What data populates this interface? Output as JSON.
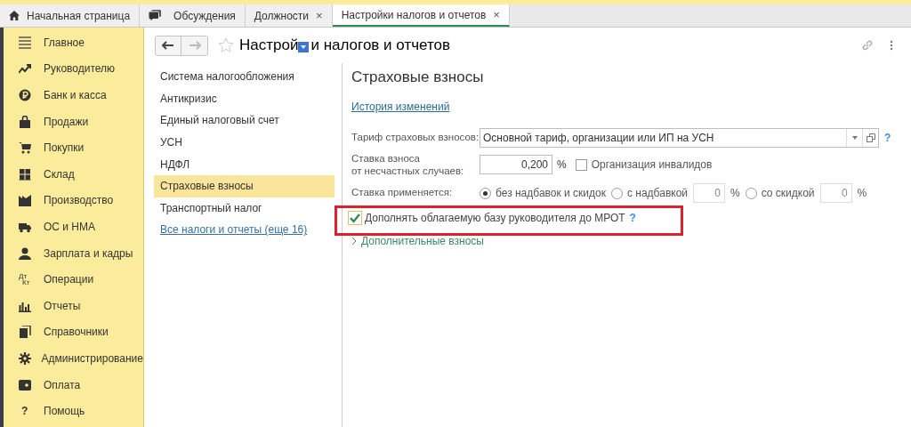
{
  "tabs": [
    {
      "label": "Начальная страница",
      "selected": false
    },
    {
      "label": "Обсуждения",
      "selected": false
    },
    {
      "label": "Должности",
      "close": "×",
      "selected": false
    },
    {
      "label": "Настройки налогов и отчетов",
      "close": "×",
      "selected": true
    }
  ],
  "sidebar": {
    "items": [
      {
        "label": "Главное"
      },
      {
        "label": "Руководителю"
      },
      {
        "label": "Банк и касса"
      },
      {
        "label": "Продажи"
      },
      {
        "label": "Покупки"
      },
      {
        "label": "Склад"
      },
      {
        "label": "Производство"
      },
      {
        "label": "ОС и НМА"
      },
      {
        "label": "Зарплата и кадры"
      },
      {
        "label": "Операции",
        "icon_text": [
          "Дт",
          "Кт"
        ]
      },
      {
        "label": "Отчеты"
      },
      {
        "label": "Справочники"
      },
      {
        "label": "Администрирование"
      },
      {
        "label": "Оплата"
      },
      {
        "label": "Помощь",
        "icon_text": [
          "?"
        ]
      }
    ]
  },
  "header": {
    "title_start": "Настрой",
    "title_end": "и налогов и отчетов"
  },
  "sections": {
    "items": [
      {
        "label": "Система налогообложения",
        "selected": false
      },
      {
        "label": "Антикризис",
        "selected": false
      },
      {
        "label": "Единый налоговый счет",
        "selected": false
      },
      {
        "label": "УСН",
        "selected": false
      },
      {
        "label": "НДФЛ",
        "selected": false
      },
      {
        "label": "Страховые взносы",
        "selected": true
      },
      {
        "label": "Транспортный налог",
        "selected": false
      }
    ],
    "more_link": "Все налоги и отчеты (еще 16)"
  },
  "content": {
    "title": "Страховые взносы",
    "history_link": "История изменений",
    "tariff": {
      "label": "Тариф страховых взносов:",
      "value": "Основной тариф, организации или ИП на УСН",
      "help": "?"
    },
    "accident_rate": {
      "label_line1": "Ставка взноса",
      "label_line2": "от несчастных случаев:",
      "value": "0,200",
      "unit": "%"
    },
    "disabled_org": {
      "label": "Организация инвалидов",
      "checked": false
    },
    "rate_applies": {
      "label": "Ставка применяется:",
      "options": [
        {
          "label": "без надбавок и скидок",
          "selected": true
        },
        {
          "label": "с надбавкой",
          "value": "0",
          "unit": "%",
          "selected": false
        },
        {
          "label": "со скидкой",
          "value": "0",
          "unit": "%",
          "selected": false
        }
      ]
    },
    "supplement": {
      "label": "Дополнять облагаемую базу руководителя до МРОТ",
      "checked": true,
      "help": "?"
    },
    "extra_group": {
      "label": "Дополнительные взносы",
      "expanded": false
    }
  }
}
